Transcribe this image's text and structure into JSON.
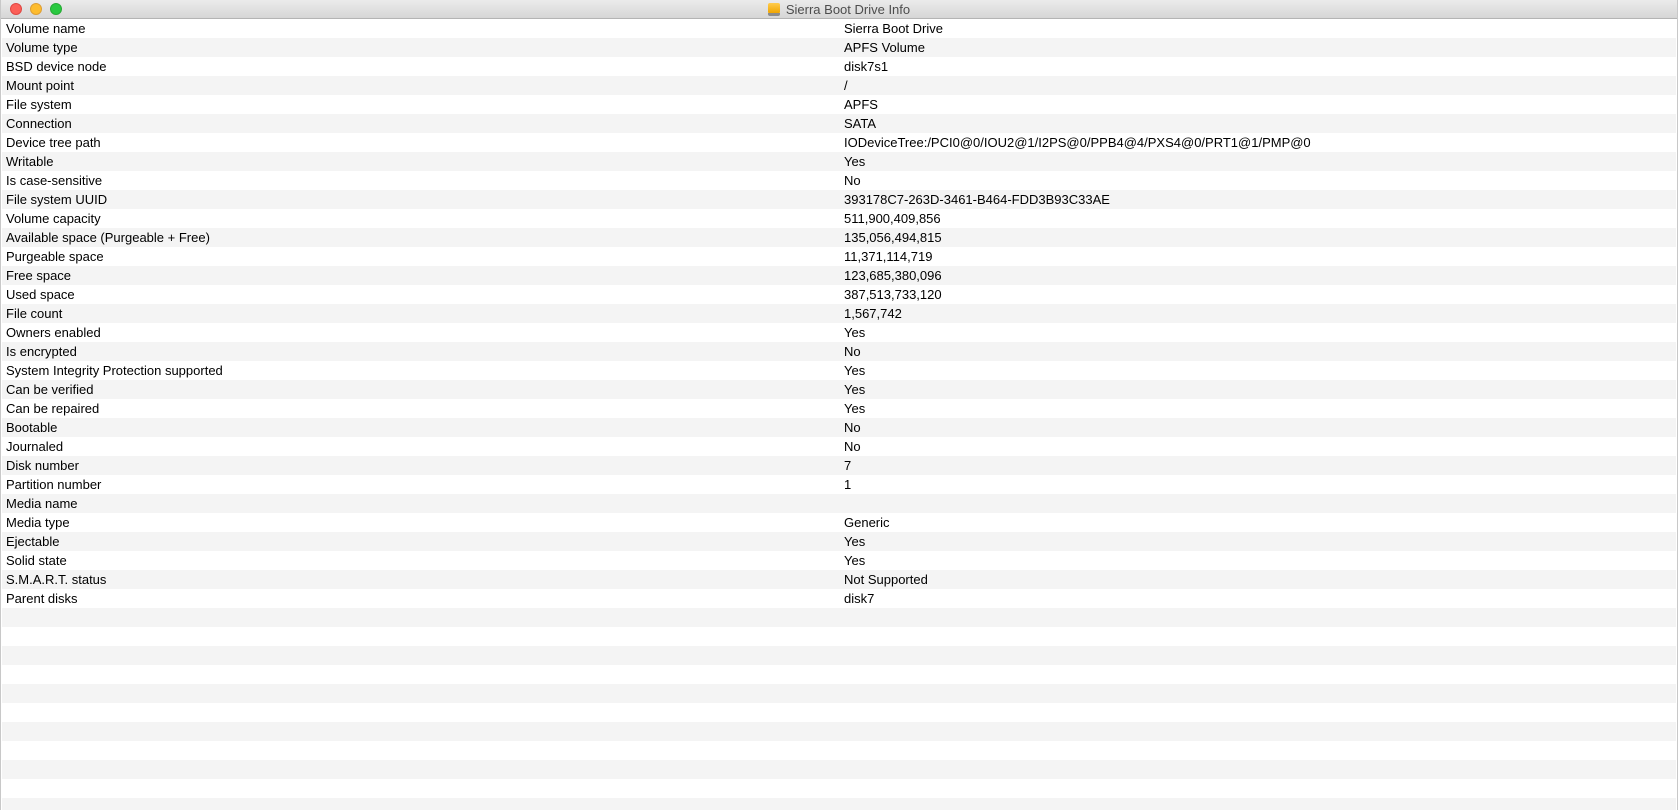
{
  "window": {
    "title": "Sierra Boot Drive Info",
    "title_icon": "drive-icon"
  },
  "colors": {
    "close": "#fc5f57",
    "minimize": "#fdbc2e",
    "zoom": "#29c940",
    "row_alt": "#f4f4f4"
  },
  "info": {
    "rows": [
      {
        "label": "Volume name",
        "value": "Sierra Boot Drive"
      },
      {
        "label": "Volume type",
        "value": "APFS Volume"
      },
      {
        "label": "BSD device node",
        "value": "disk7s1"
      },
      {
        "label": "Mount point",
        "value": "/"
      },
      {
        "label": "File system",
        "value": "APFS"
      },
      {
        "label": "Connection",
        "value": "SATA"
      },
      {
        "label": "Device tree path",
        "value": "IODeviceTree:/PCI0@0/IOU2@1/I2PS@0/PPB4@4/PXS4@0/PRT1@1/PMP@0"
      },
      {
        "label": "Writable",
        "value": "Yes"
      },
      {
        "label": "Is case-sensitive",
        "value": "No"
      },
      {
        "label": "File system UUID",
        "value": "393178C7-263D-3461-B464-FDD3B93C33AE"
      },
      {
        "label": "Volume capacity",
        "value": "511,900,409,856"
      },
      {
        "label": "Available space (Purgeable + Free)",
        "value": "135,056,494,815"
      },
      {
        "label": "Purgeable space",
        "value": "11,371,114,719"
      },
      {
        "label": "Free space",
        "value": "123,685,380,096"
      },
      {
        "label": "Used space",
        "value": "387,513,733,120"
      },
      {
        "label": "File count",
        "value": "1,567,742"
      },
      {
        "label": "Owners enabled",
        "value": "Yes"
      },
      {
        "label": "Is encrypted",
        "value": "No"
      },
      {
        "label": "System Integrity Protection supported",
        "value": "Yes"
      },
      {
        "label": "Can be verified",
        "value": "Yes"
      },
      {
        "label": "Can be repaired",
        "value": "Yes"
      },
      {
        "label": "Bootable",
        "value": "No"
      },
      {
        "label": "Journaled",
        "value": "No"
      },
      {
        "label": "Disk number",
        "value": "7"
      },
      {
        "label": "Partition number",
        "value": "1"
      },
      {
        "label": "Media name",
        "value": ""
      },
      {
        "label": "Media type",
        "value": "Generic"
      },
      {
        "label": "Ejectable",
        "value": "Yes"
      },
      {
        "label": "Solid state",
        "value": "Yes"
      },
      {
        "label": "S.M.A.R.T. status",
        "value": "Not Supported"
      },
      {
        "label": "Parent disks",
        "value": "disk7"
      }
    ]
  }
}
